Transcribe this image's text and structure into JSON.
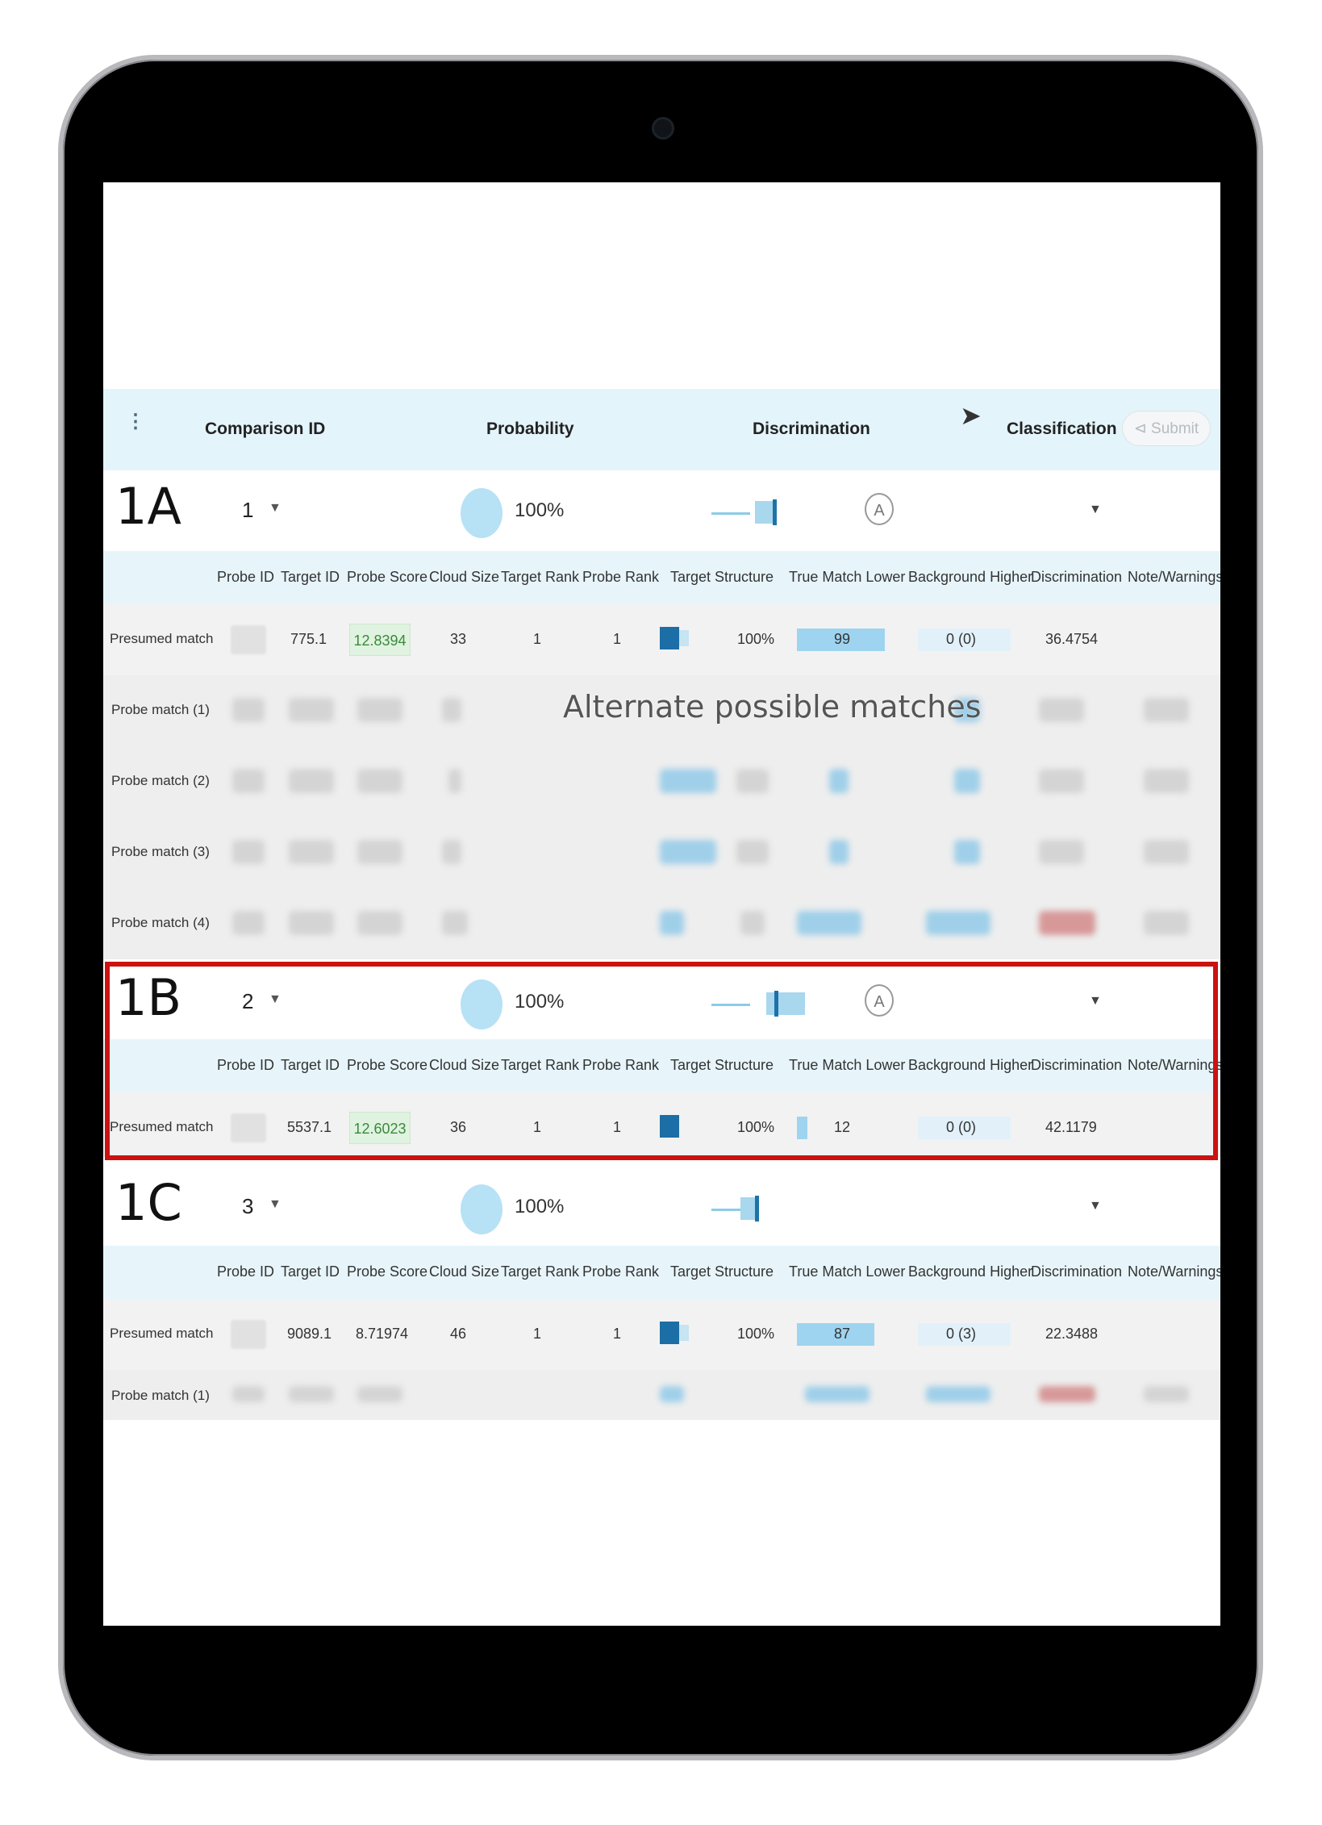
{
  "header": {
    "comparison_id": "Comparison ID",
    "probability": "Probability",
    "discrimination": "Discrimination",
    "classification": "Classification",
    "submit_label": "⊲ Submit"
  },
  "columns": [
    "Probe ID",
    "Target ID",
    "Probe Score",
    "Cloud Size",
    "Target Rank",
    "Probe Rank",
    "Target Structure",
    "True Match Lower",
    "Background Higher",
    "Discrimination",
    "Note/Warnings"
  ],
  "overlay_label": "Alternate possible matches",
  "groups": [
    {
      "label": "1A",
      "comparison_id": "1",
      "probability": "100%",
      "has_a_icon": true,
      "a_icon_text": "A",
      "presumed": {
        "row_label": "Presumed match",
        "target_id": "775.1",
        "probe_score": "12.8394",
        "cloud_size": "33",
        "target_rank": "1",
        "probe_rank": "1",
        "target_structure": "100%",
        "true_match_lower": "99",
        "background_higher": "0 (0)",
        "discrimination": "36.4754"
      },
      "alternates": [
        "Probe match (1)",
        "Probe match (2)",
        "Probe match (3)",
        "Probe match (4)"
      ]
    },
    {
      "label": "1B",
      "comparison_id": "2",
      "probability": "100%",
      "has_a_icon": true,
      "a_icon_text": "A",
      "presumed": {
        "row_label": "Presumed match",
        "target_id": "5537.1",
        "probe_score": "12.6023",
        "cloud_size": "36",
        "target_rank": "1",
        "probe_rank": "1",
        "target_structure": "100%",
        "true_match_lower": "12",
        "background_higher": "0 (0)",
        "discrimination": "42.1179"
      }
    },
    {
      "label": "1C",
      "comparison_id": "3",
      "probability": "100%",
      "has_a_icon": false,
      "presumed": {
        "row_label": "Presumed match",
        "target_id": "9089.1",
        "probe_score": "8.71974",
        "cloud_size": "46",
        "target_rank": "1",
        "probe_rank": "1",
        "target_structure": "100%",
        "true_match_lower": "87",
        "background_higher": "0 (3)",
        "discrimination": "22.3488"
      },
      "alternates": [
        "Probe match (1)"
      ]
    }
  ],
  "true_match_lower_levels": [
    0.99,
    0.12,
    0.87
  ],
  "icons": {
    "sort": "sort-updown-icon",
    "caret": "caret-down-icon",
    "cursor": "mouse-pointer-icon"
  },
  "colors": {
    "highlight": "#cc1111",
    "header_bg": "#e4f4fb",
    "accent_blue": "#1c6ea6"
  }
}
